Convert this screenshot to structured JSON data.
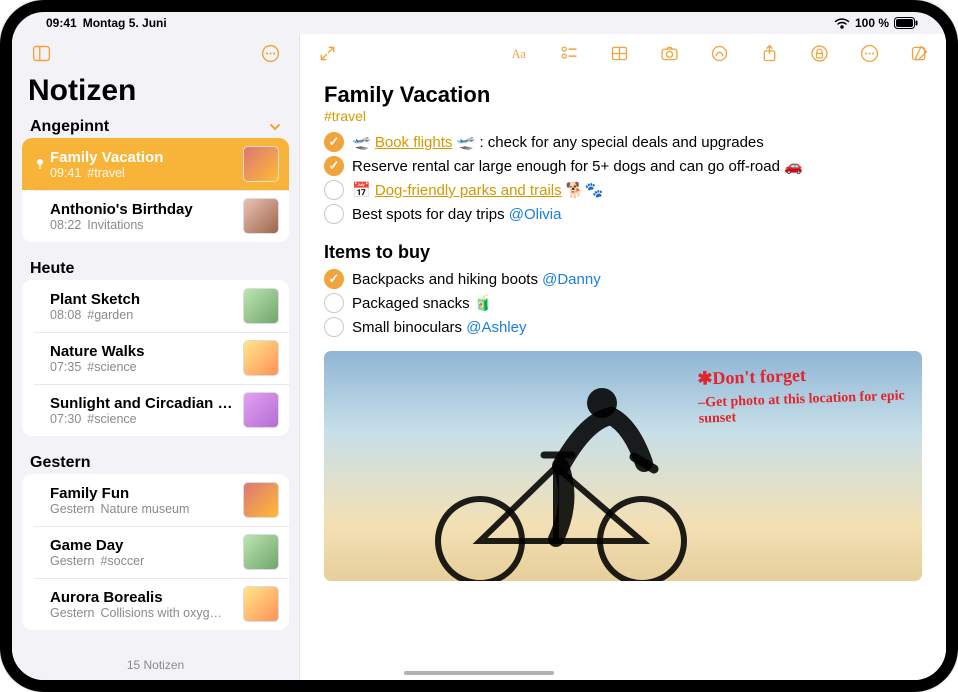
{
  "status": {
    "time": "09:41",
    "date": "Montag 5. Juni",
    "battery": "100 %"
  },
  "sidebar": {
    "title": "Notizen",
    "footer": "15 Notizen",
    "sections": [
      {
        "header": "Angepinnt",
        "items": [
          {
            "pinned": true,
            "selected": true,
            "title": "Family Vacation",
            "time": "09:41",
            "snippet": "#travel"
          },
          {
            "pinned": false,
            "selected": false,
            "title": "Anthonio's Birthday",
            "time": "08:22",
            "snippet": "Invitations"
          }
        ]
      },
      {
        "header": "Heute",
        "items": [
          {
            "title": "Plant Sketch",
            "time": "08:08",
            "snippet": "#garden"
          },
          {
            "title": "Nature Walks",
            "time": "07:35",
            "snippet": "#science"
          },
          {
            "title": "Sunlight and Circadian Rhy…",
            "time": "07:30",
            "snippet": "#science"
          }
        ]
      },
      {
        "header": "Gestern",
        "items": [
          {
            "title": "Family Fun",
            "time": "Gestern",
            "snippet": "Nature museum"
          },
          {
            "title": "Game Day",
            "time": "Gestern",
            "snippet": "#soccer"
          },
          {
            "title": "Aurora Borealis",
            "time": "Gestern",
            "snippet": "Collisions with oxyg…"
          }
        ]
      }
    ]
  },
  "note": {
    "title": "Family Vacation",
    "tag": "#travel",
    "list1": [
      {
        "done": true,
        "prefix_emoji": "🛫",
        "link": "Book flights",
        "suffix_emoji": "🛫",
        "rest": ": check for any special deals and upgrades"
      },
      {
        "done": true,
        "text": "Reserve rental car large enough for 5+ dogs and can go off-road 🚗"
      },
      {
        "done": false,
        "link_icon": "📅",
        "link": "Dog-friendly parks and trails",
        "rest": " 🐕🐾"
      },
      {
        "done": false,
        "text": "Best spots for day trips ",
        "mention": "@Olivia"
      }
    ],
    "heading2": "Items to buy",
    "list2": [
      {
        "done": true,
        "text": "Backpacks and hiking boots ",
        "mention": "@Danny"
      },
      {
        "done": false,
        "text": "Packaged snacks 🧃"
      },
      {
        "done": false,
        "text": "Small binoculars ",
        "mention": "@Ashley"
      }
    ],
    "handwriting_main": "✱Don't forget",
    "handwriting_sub": "–Get photo at this location for epic sunset"
  }
}
